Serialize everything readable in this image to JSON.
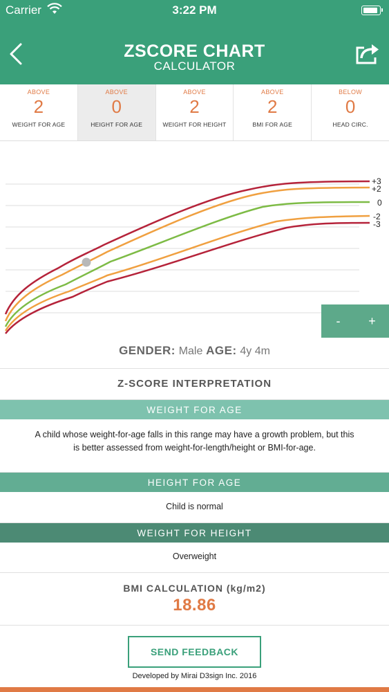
{
  "status_bar": {
    "carrier": "Carrier",
    "time": "3:22 PM"
  },
  "header": {
    "title": "ZSCORE CHART",
    "subtitle": "CALCULATOR",
    "accent_color": "#3aa07a"
  },
  "stats": [
    {
      "direction": "ABOVE",
      "value": "2",
      "label": "WEIGHT FOR AGE"
    },
    {
      "direction": "ABOVE",
      "value": "0",
      "label": "HEIGHT FOR AGE"
    },
    {
      "direction": "ABOVE",
      "value": "2",
      "label": "WEIGHT FOR HEIGHT"
    },
    {
      "direction": "ABOVE",
      "value": "2",
      "label": "BMI FOR AGE"
    },
    {
      "direction": "BELOW",
      "value": "0",
      "label": "HEAD CIRC."
    }
  ],
  "chart_data": {
    "type": "line",
    "series": [
      {
        "name": "+3",
        "color": "#b5233a"
      },
      {
        "name": "+2",
        "color": "#f0a040"
      },
      {
        "name": "0",
        "color": "#7dbb45"
      },
      {
        "name": "-2",
        "color": "#f0a040"
      },
      {
        "name": "-3",
        "color": "#b5233a"
      }
    ],
    "grid": true
  },
  "zoom": {
    "minus": "-",
    "plus": "+"
  },
  "patient": {
    "gender_label": "GENDER:",
    "gender": "Male",
    "age_label": "AGE:",
    "age": "4y 4m"
  },
  "interpretation": {
    "title": "Z-SCORE INTERPRETATION",
    "weight_for_age": {
      "label": "WEIGHT FOR AGE",
      "text": "A child whose weight-for-age falls in this range may have a growth problem, but this is better assessed from weight-for-length/height or BMI-for-age."
    },
    "height_for_age": {
      "label": "HEIGHT FOR AGE",
      "text": "Child is normal"
    },
    "weight_for_height": {
      "label": "WEIGHT FOR HEIGHT",
      "text": "Overweight"
    }
  },
  "bmi": {
    "label": "BMI CALCULATION (kg/m2)",
    "value": "18.86"
  },
  "feedback_button": "SEND FEEDBACK",
  "footer": "Developed by Mirai D3sign Inc. 2016"
}
